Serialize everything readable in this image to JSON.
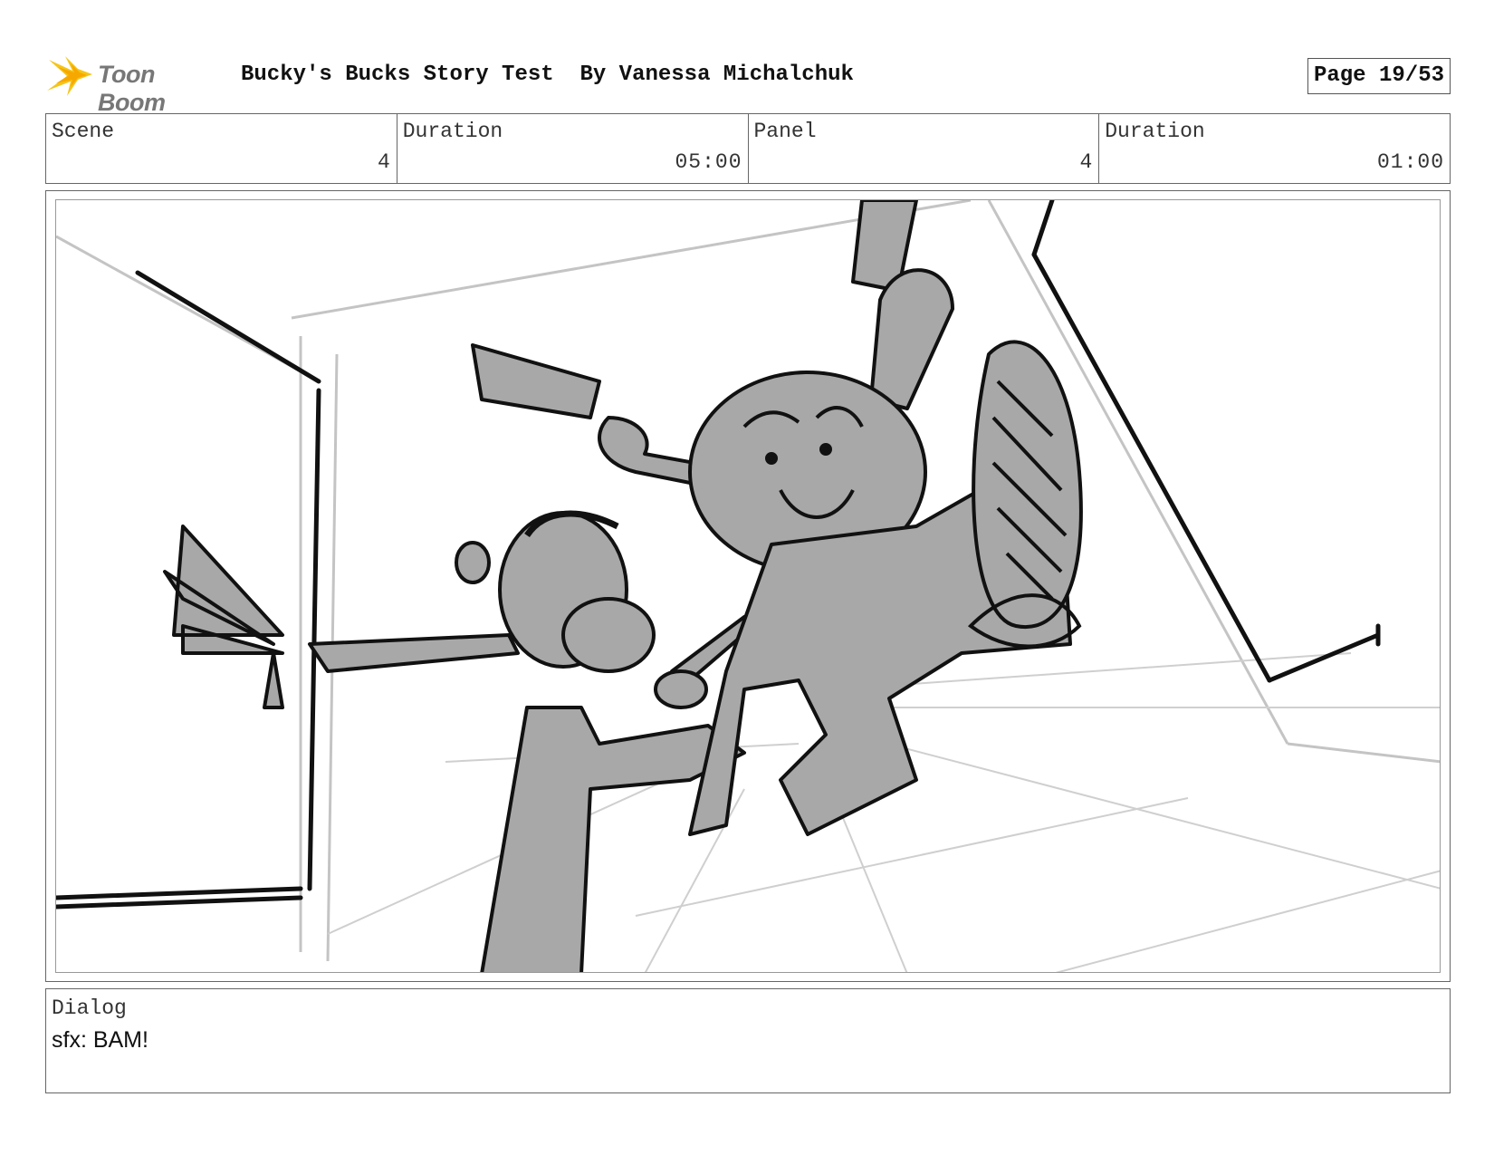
{
  "header": {
    "logo_text": "Toon Boom",
    "title": "Bucky's Bucks Story Test  By Vanessa Michalchuk",
    "page": "Page 19/53"
  },
  "info": {
    "scene_label": "Scene",
    "scene_value": "4",
    "scene_duration_label": "Duration",
    "scene_duration_value": "05:00",
    "panel_label": "Panel",
    "panel_value": "4",
    "panel_duration_label": "Duration",
    "panel_duration_value": "01:00"
  },
  "dialog": {
    "label": "Dialog",
    "text": "sfx: BAM!"
  },
  "colors": {
    "logo_yellow": "#f5c518",
    "sketch_gray": "#a8a8a8",
    "ink": "#111111"
  }
}
